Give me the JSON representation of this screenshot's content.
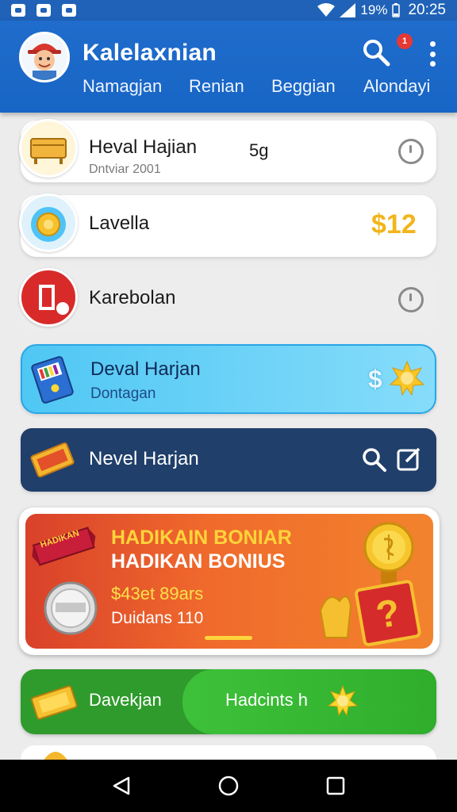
{
  "status_bar": {
    "battery": "19%",
    "time": "20:25"
  },
  "header": {
    "title": "Kalelaxnian",
    "notification_count": "1",
    "tabs": [
      "Namagjan",
      "Renian",
      "Beggian",
      "Alondayi"
    ]
  },
  "list": {
    "item1": {
      "title": "Heval Hajian",
      "sub": "Dntviar 2001",
      "value": "5g"
    },
    "item2": {
      "title": "Lavella",
      "value": "$12"
    },
    "item3": {
      "title": "Karebolan"
    },
    "item4": {
      "title": "Deval Harjan",
      "sub": "Dontagan",
      "value": "$"
    },
    "item5": {
      "title": "Nevel Harjan"
    }
  },
  "promo": {
    "heading": "HADIKAIN BONIAR",
    "subheading": "HADIKAN BONIUS",
    "amount": "$43et 89ars",
    "label": "Duidans 110",
    "badge": "HADIKAN"
  },
  "green_card": {
    "left_label": "Davekjan",
    "right_label": "Hadcints h"
  },
  "colors": {
    "header_blue": "#1f6ccc",
    "promo_orange": "#f06a2c",
    "green": "#3ec13a",
    "navy": "#203f6a"
  }
}
